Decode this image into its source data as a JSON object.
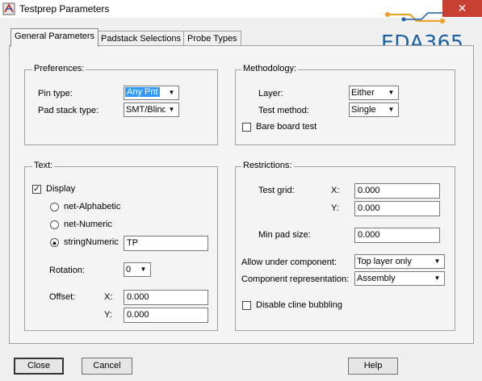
{
  "window": {
    "title": "Testprep Parameters",
    "close_glyph": "✕",
    "watermark": "EDA365"
  },
  "tabs": [
    {
      "label": "General Parameters",
      "active": true
    },
    {
      "label": "Padstack Selections",
      "active": false
    },
    {
      "label": "Probe Types",
      "active": false
    }
  ],
  "preferences": {
    "title": "Preferences:",
    "pin_type_label": "Pin type:",
    "pin_type_value": "Any Pnt",
    "pad_stack_label": "Pad stack type:",
    "pad_stack_value": "SMT/Blind"
  },
  "methodology": {
    "title": "Methodology:",
    "layer_label": "Layer:",
    "layer_value": "Either",
    "test_method_label": "Test method:",
    "test_method_value": "Single",
    "bare_board_label": "Bare board test",
    "bare_board_checked": false
  },
  "text": {
    "title": "Text:",
    "display_label": "Display",
    "display_checked": true,
    "options": [
      {
        "label": "net-Alphabetic",
        "selected": false
      },
      {
        "label": "net-Numeric",
        "selected": false
      },
      {
        "label": "stringNumeric",
        "selected": true
      }
    ],
    "string_value": "TP",
    "rotation_label": "Rotation:",
    "rotation_value": "0",
    "offset_label": "Offset:",
    "x_label": "X:",
    "x_value": "0.000",
    "y_label": "Y:",
    "y_value": "0.000"
  },
  "restrictions": {
    "title": "Restrictions:",
    "test_grid_label": "Test grid:",
    "x_label": "X:",
    "x_value": "0.000",
    "y_label": "Y:",
    "y_value": "0.000",
    "min_pad_label": "Min pad size:",
    "min_pad_value": "0.000",
    "allow_under_label": "Allow under component:",
    "allow_under_value": "Top layer only",
    "component_rep_label": "Component representation:",
    "component_rep_value": "Assembly",
    "disable_cline_label": "Disable cline bubbling",
    "disable_cline_checked": false
  },
  "buttons": {
    "close": "Close",
    "cancel": "Cancel",
    "help": "Help"
  },
  "colors": {
    "selection": "#3399ff",
    "close_button": "#c84031",
    "logo_blue": "#1b5fa8",
    "logo_orange": "#f0a020"
  }
}
